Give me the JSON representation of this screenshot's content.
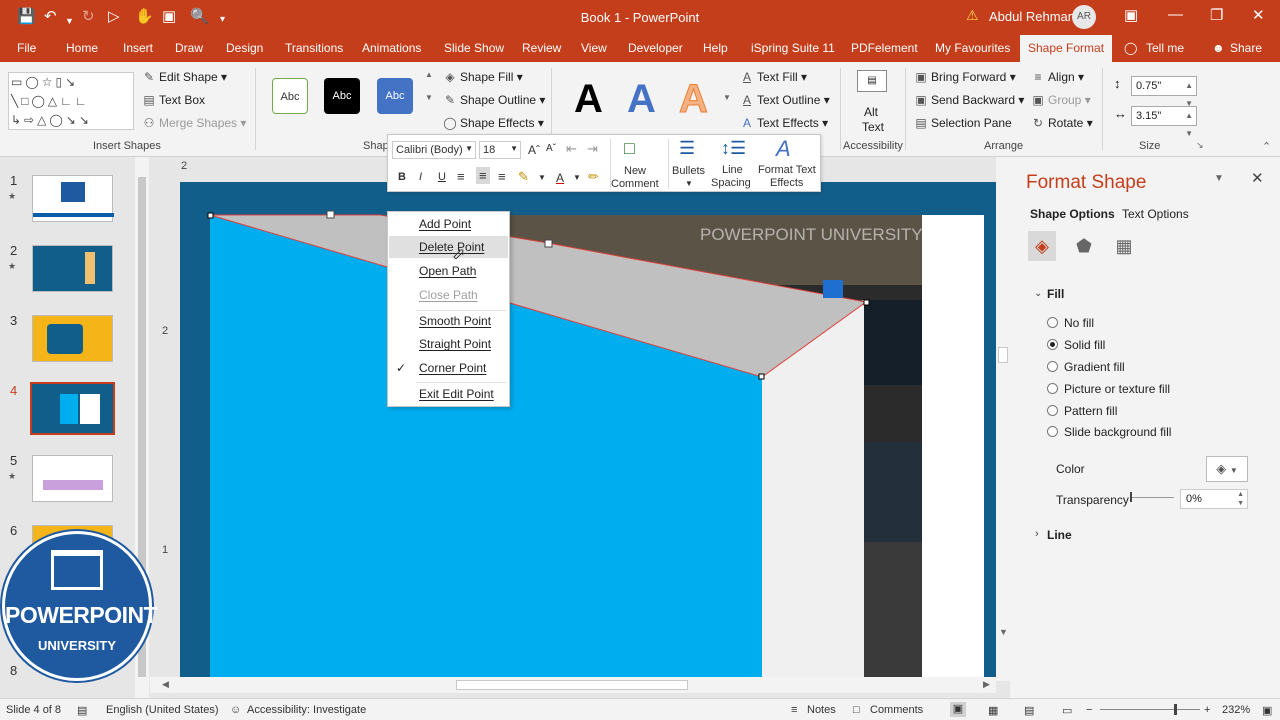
{
  "window": {
    "title": "Book 1  -  PowerPoint",
    "user_name": "Abdul Rehman",
    "user_initials": "AR"
  },
  "tabs": [
    "File",
    "Home",
    "Insert",
    "Draw",
    "Design",
    "Transitions",
    "Animations",
    "Slide Show",
    "Review",
    "View",
    "Developer",
    "Help",
    "iSpring Suite 11",
    "PDFelement",
    "My Favourites",
    "Shape Format",
    "Tell me",
    "Share"
  ],
  "ribbon": {
    "edit_shape": "Edit Shape",
    "text_box": "Text Box",
    "merge_shapes": "Merge Shapes",
    "insert_shapes_label": "Insert Shapes",
    "shape_styles_label": "Shap",
    "style_text": "Abc",
    "shape_fill": "Shape Fill",
    "shape_outline": "Shape Outline",
    "shape_effects": "Shape Effects",
    "wordart_letter": "A",
    "text_fill": "Text Fill",
    "text_outline": "Text Outline",
    "text_effects": "Text Effects",
    "alt_text_1": "Alt",
    "alt_text_2": "Text",
    "accessibility_label": "Accessibility",
    "bring_forward": "Bring Forward",
    "send_backward": "Send Backward",
    "selection_pane": "Selection Pane",
    "align": "Align",
    "group": "Group",
    "rotate": "Rotate",
    "arrange_label": "Arrange",
    "height_value": "0.75\"",
    "width_value": "3.15\"",
    "size_label": "Size"
  },
  "mini_toolbar": {
    "font": "Calibri (Body)",
    "size": "18",
    "new_comment_1": "New",
    "new_comment_2": "Comment",
    "bullets": "Bullets",
    "line_spacing_1": "Line",
    "line_spacing_2": "Spacing",
    "format_text_1": "Format Text",
    "format_text_2": "Effects"
  },
  "context_menu": [
    {
      "label": "Add Point",
      "disabled": false
    },
    {
      "label": "Delete Point",
      "disabled": false
    },
    {
      "label": "Open Path",
      "disabled": false
    },
    {
      "label": "Close Path",
      "disabled": true
    },
    {
      "label": "Smooth Point",
      "disabled": false
    },
    {
      "label": "Straight Point",
      "disabled": false
    },
    {
      "label": "Corner Point",
      "disabled": false,
      "checked": true
    },
    {
      "label": "Exit Edit Point",
      "disabled": false
    }
  ],
  "slides": [
    "1",
    "2",
    "3",
    "4",
    "5",
    "6",
    "8"
  ],
  "slide_text": "POWERPOINT UNIVERSITY",
  "format_panel": {
    "title": "Format Shape",
    "tab_shape": "Shape Options",
    "tab_text": "Text Options",
    "fill_header": "Fill",
    "options": [
      {
        "label": "No fill",
        "selected": false
      },
      {
        "label": "Solid fill",
        "selected": true
      },
      {
        "label": "Gradient fill",
        "selected": false
      },
      {
        "label": "Picture or texture fill",
        "selected": false
      },
      {
        "label": "Pattern fill",
        "selected": false
      },
      {
        "label": "Slide background fill",
        "selected": false
      }
    ],
    "color_label": "Color",
    "transparency_label": "Transparency",
    "transparency_value": "0%",
    "line_header": "Line"
  },
  "logo": {
    "line1": "POWERPOINT",
    "line2": "UNIVERSITY"
  },
  "status": {
    "slide": "Slide 4 of 8",
    "language": "English (United States)",
    "accessibility": "Accessibility: Investigate",
    "notes": "Notes",
    "comments": "Comments",
    "zoom": "232%"
  },
  "colors": {
    "accent": "#c43e1c",
    "shape_blue": "#00aeef",
    "shape_gray": "#c0c0c0",
    "slide_bg": "#115e8a"
  }
}
